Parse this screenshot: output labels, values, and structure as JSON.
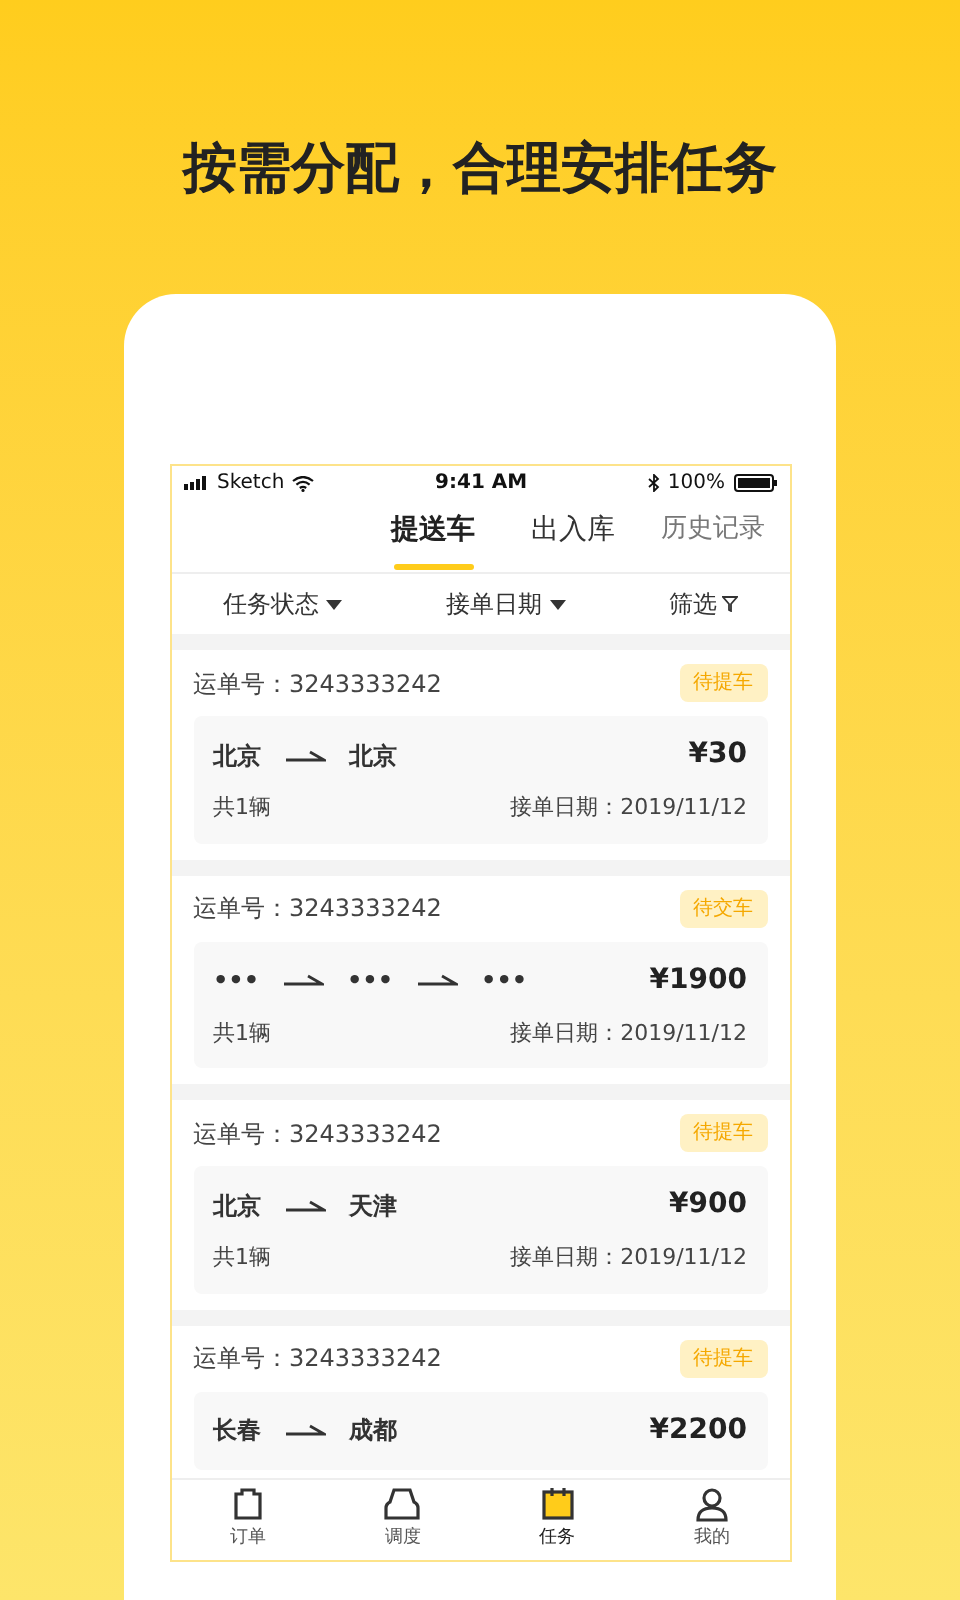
{
  "headline": "按需分配，合理安排任务",
  "status_bar": {
    "carrier": "Sketch",
    "time": "9:41 AM",
    "battery": "100%"
  },
  "tabs": [
    {
      "label": "提送车",
      "selected": true
    },
    {
      "label": "出入库",
      "selected": false
    }
  ],
  "history_link": "历史记录",
  "filters": [
    {
      "label": "任务状态",
      "kind": "dropdown"
    },
    {
      "label": "接单日期",
      "kind": "dropdown"
    },
    {
      "label": "筛选",
      "kind": "filter"
    }
  ],
  "orders": [
    {
      "number_label": "运单号：3243333242",
      "status": "待提车",
      "stops": [
        "北京",
        "北京"
      ],
      "price": "¥30",
      "count": "共1辆",
      "date": "接单日期：2019/11/12"
    },
    {
      "number_label": "运单号：3243333242",
      "status": "待交车",
      "stops": [
        "•••",
        "•••",
        "•••"
      ],
      "price": "¥1900",
      "count": "共1辆",
      "date": "接单日期：2019/11/12"
    },
    {
      "number_label": "运单号：3243333242",
      "status": "待提车",
      "stops": [
        "北京",
        "天津"
      ],
      "price": "¥900",
      "count": "共1辆",
      "date": "接单日期：2019/11/12"
    },
    {
      "number_label": "运单号：3243333242",
      "status": "待提车",
      "stops": [
        "长春",
        "成都"
      ],
      "price": "¥2200"
    }
  ],
  "bottom_nav": [
    {
      "label": "订单",
      "kind": "bag",
      "selected": false
    },
    {
      "label": "调度",
      "kind": "car",
      "selected": false
    },
    {
      "label": "任务",
      "kind": "calendar",
      "selected": true
    },
    {
      "label": "我的",
      "kind": "person",
      "selected": false
    }
  ]
}
